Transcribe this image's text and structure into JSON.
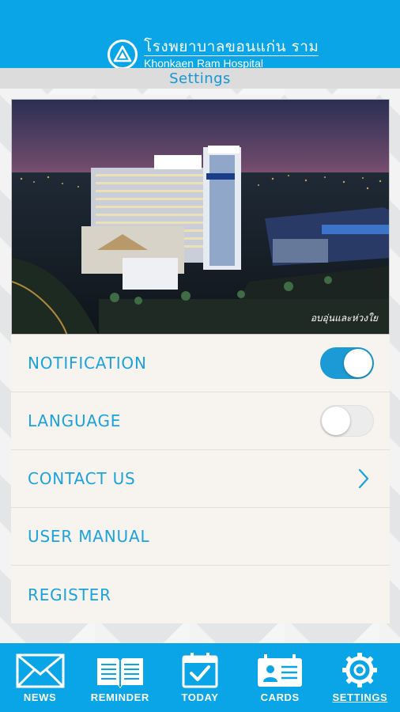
{
  "header": {
    "brand_thai": "โรงพยาบาลขอนแก่น ราม",
    "brand_english": "Khonkaen Ram Hospital",
    "page_title": "Settings"
  },
  "hero": {
    "caption": "อบอุ่นและห่วงใย"
  },
  "settings": {
    "items": [
      {
        "label": "NOTIFICATION",
        "control": "toggle",
        "value": "on"
      },
      {
        "label": "LANGUAGE",
        "control": "toggle",
        "value": "off"
      },
      {
        "label": "CONTACT US",
        "control": "chevron-right-icon"
      },
      {
        "label": "USER MANUAL",
        "control": "none"
      },
      {
        "label": "REGISTER",
        "control": "none"
      }
    ]
  },
  "bottom_nav": {
    "items": [
      {
        "label": "NEWS",
        "icon": "envelope-icon"
      },
      {
        "label": "REMINDER",
        "icon": "book-icon"
      },
      {
        "label": "TODAY",
        "icon": "calendar-check-icon"
      },
      {
        "label": "CARDS",
        "icon": "id-card-icon"
      },
      {
        "label": "SETTINGS",
        "icon": "gear-icon",
        "active": true
      }
    ]
  },
  "colors": {
    "primary": "#0aa5e6",
    "accent_text": "#1ba2df",
    "toggle_on": "#1b9ad6",
    "row_background": "#f7f3ef"
  }
}
